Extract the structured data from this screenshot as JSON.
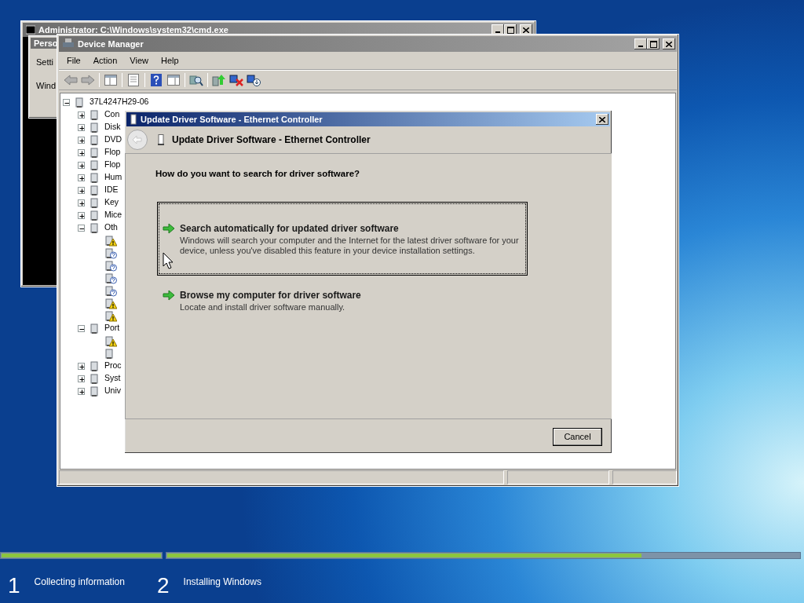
{
  "cmd_window": {
    "title": "Administrator: C:\\Windows\\system32\\cmd.exe"
  },
  "personalization_window": {
    "title": "Perso",
    "items": [
      "Setti",
      "Wind"
    ]
  },
  "device_manager": {
    "title": "Device Manager",
    "menu": [
      "File",
      "Action",
      "View",
      "Help"
    ],
    "tree": {
      "label": "37L4247H29-06",
      "expanded": true,
      "children": [
        {
          "label": "Con",
          "expanded": false
        },
        {
          "label": "Disk",
          "expanded": false
        },
        {
          "label": "DVD",
          "expanded": false
        },
        {
          "label": "Flop",
          "expanded": false
        },
        {
          "label": "Flop",
          "expanded": false
        },
        {
          "label": "Hum",
          "expanded": false
        },
        {
          "label": "IDE",
          "expanded": false
        },
        {
          "label": "Key",
          "expanded": false
        },
        {
          "label": "Mice",
          "expanded": false
        },
        {
          "label": "Oth",
          "expanded": true,
          "children": [
            {
              "kind": "warning"
            },
            {
              "kind": "unknown"
            },
            {
              "kind": "unknown"
            },
            {
              "kind": "unknown"
            },
            {
              "kind": "unknown"
            },
            {
              "kind": "warning"
            },
            {
              "kind": "warning"
            }
          ]
        },
        {
          "label": "Port",
          "expanded": true,
          "children": [
            {
              "kind": "warning"
            },
            {
              "kind": "plain"
            }
          ]
        },
        {
          "label": "Proc",
          "expanded": false
        },
        {
          "label": "Syst",
          "expanded": false
        },
        {
          "label": "Univ",
          "expanded": false
        }
      ]
    }
  },
  "dialog": {
    "title": "Update Driver Software - Ethernet Controller",
    "heading": "Update Driver Software - Ethernet Controller",
    "question": "How do you want to search for driver software?",
    "options": [
      {
        "title": "Search automatically for updated driver software",
        "description": "Windows will search your computer and the Internet for the latest driver software for your device, unless you've disabled this feature in your device installation settings.",
        "selected": true
      },
      {
        "title": "Browse my computer for driver software",
        "description": "Locate and install driver software manually.",
        "selected": false
      }
    ],
    "buttons": [
      "Cancel"
    ]
  },
  "setup_progress": [
    {
      "number": "1",
      "label": "Collecting information",
      "level": 1
    },
    {
      "number": "2",
      "label": "Installing Windows",
      "level": 0.75
    }
  ]
}
